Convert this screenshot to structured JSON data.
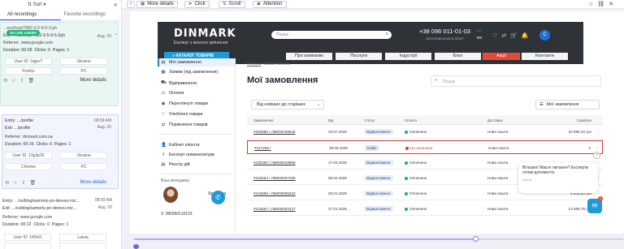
{
  "left_panel": {
    "sort_label": "Sort",
    "tabs": [
      "All recordings",
      "Favorite recordings"
    ],
    "favorite_count_suffix": "",
    "live_badge": "40 LIVE USERS",
    "cards": [
      {
        "exit": "...nu/shop/7982-3-5-9-5-2.ph",
        "exit2": "...nu/shop/7982-3-5-9-5-2ph",
        "date": "Aug. 20",
        "referrer": "Referrer: www.google.com",
        "duration": "Duration: 00:09",
        "clicks": "Clicks: 0",
        "pages": "Pages: 1",
        "user_id": "User ID: 1tgpvT",
        "country": "Ukraine",
        "browser": "Firefox",
        "device": "PC",
        "more": "More details"
      },
      {
        "entry": "Entry: .../profile",
        "exit": "Exit: .../profile",
        "time": "08:59 AM",
        "date": "Aug. 20",
        "referrer": "Referrer: dinmark.com.ua",
        "duration": "Duration: 00:16",
        "clicks": "Clicks: 0",
        "pages": "Pages: 1",
        "user_id": "User ID: 13g3p35",
        "country": "Ukraine",
        "browser": "Chrome",
        "device": "PC",
        "more": "More details"
      },
      {
        "entry": "Entry: .../ru/blog/samoriy-po-derevu-roz...",
        "exit": "Exit: .../ru/blog/samoriy-po-derevu-roz...",
        "time": "08:59 AM",
        "date": "Aug. 20",
        "referrer": "Referrer: www.google.com",
        "duration": "Duration: 00:22",
        "clicks": "Clicks: 0",
        "pages": "Pages: 1",
        "user_id": "User ID: 1f6941",
        "country": "Latvia"
      }
    ]
  },
  "toolbar": {
    "more_details": "More details",
    "click": "Click",
    "scroll": "Scroll",
    "attention": "Attention"
  },
  "site": {
    "logo": "DINMARK",
    "logo_sub": "Експерт з якісного кріплення",
    "search_placeholder": "Пошук",
    "phone": "+38 096 011-01-03",
    "phone_sub": "Зателефонувати Вам?",
    "lang_ua": "UA",
    "lang_en": "EN",
    "avatar_letter": "C",
    "catalog": "КАТАЛОГ ТОВАРІВ",
    "nav": [
      "Про компанію",
      "Послуги",
      "Індустрії",
      "Блог",
      "Акції",
      "Контакти"
    ],
    "sale_color": "#e14b3a"
  },
  "side_menu": {
    "items": [
      "Мої замовлення",
      "Заявки (під замовлення)",
      "Відправлення",
      "Оплати",
      "Переглянуті товари",
      "Улюблені товари",
      "Порівняння товарів"
    ],
    "items2": [
      "Кабінет клієнта",
      "Експорт номенклатури",
      "Реєстр дій"
    ],
    "manager_label": "Ваш менеджер",
    "manager_name": "Христина",
    "manager_phone": "380960110103"
  },
  "main": {
    "breadcrumb_home": "Головна",
    "breadcrumb_rest": "/ Кабінет клієнта",
    "title": "Мої замовлення",
    "search_placeholder": "Пошук",
    "sort_value": "Від новіших до старіших",
    "filter_label": "Мої замовлення",
    "columns": [
      "Замовлення",
      "Від",
      "Статус",
      "Оплата",
      "Доставка",
      "Сума/грн"
    ],
    "orders": [
      {
        "num": "#253986 / ЛМ000039630",
        "date": "23.07.2025",
        "status": "Відвантажено",
        "pay": "Оплачено",
        "ship": "Нова пошта",
        "sum": "32 990,10 грн",
        "hl": false,
        "err": false
      },
      {
        "num": "#247259 /",
        "date": "29.06.2025",
        "status": "Нове",
        "pay": "Не оплачено",
        "ship": "Нова пошта",
        "sum": "0",
        "hl": true,
        "err": true
      },
      {
        "num": "#230392 / ЛМ000018858",
        "date": "17.04.2025",
        "status": "Відвантажено",
        "pay": "Оплачено",
        "ship": "Нова пошта",
        "sum": "",
        "hl": false,
        "err": false
      },
      {
        "num": "#218054 / ЛМ000007305",
        "date": "06.02.2025",
        "status": "Відвантажено",
        "pay": "Оплачено",
        "ship": "Нова пошта",
        "sum": "",
        "hl": false,
        "err": false
      },
      {
        "num": "#216856 / ЛМ000005343",
        "date": "29.01.2025",
        "status": "Відвантажено",
        "pay": "Оплачено",
        "ship": "Нова пошта",
        "sum": "5 626,63 грн",
        "hl": false,
        "err": false
      },
      {
        "num": "#215657 / ЛМ000004127",
        "date": "27.01.2025",
        "status": "Відвантажено",
        "pay": "Оплачено",
        "ship": "Нова пошта",
        "sum": "14 685,76 грн",
        "hl": false,
        "err": false
      }
    ]
  },
  "chat": {
    "bubble": "Вітаємо! Маєте питання? Експерти готові допомогти.",
    "agent": "Ольга",
    "count": "1"
  },
  "timeline": {
    "progress": 0.7
  }
}
